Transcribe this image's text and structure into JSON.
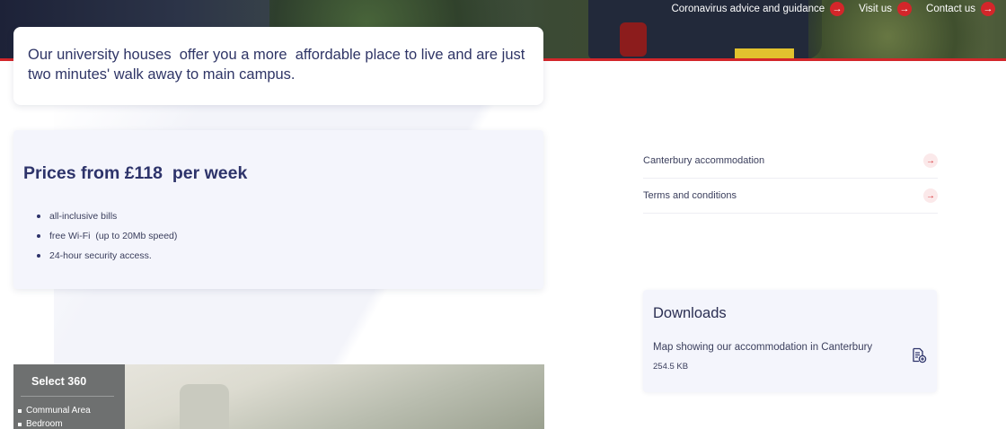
{
  "topnav": {
    "links": [
      {
        "label": "Coronavirus advice and guidance"
      },
      {
        "label": "Visit us"
      },
      {
        "label": "Contact us"
      }
    ]
  },
  "intro": {
    "text": "Our university houses  offer you a more  affordable place to live and are just two minutes' walk away to main campus."
  },
  "prices": {
    "heading": "Prices from £118  per week",
    "items": [
      "all-inclusive bills",
      "free Wi-Fi  (up to 20Mb speed)",
      "24-hour security access."
    ]
  },
  "viewer": {
    "title": "Select 360",
    "items": [
      "Communal Area",
      "Bedroom"
    ]
  },
  "sidebar": {
    "links": [
      {
        "label": "Canterbury accommodation"
      },
      {
        "label": "Terms and conditions"
      }
    ]
  },
  "downloads": {
    "title": "Downloads",
    "file": {
      "name": "Map showing our accommodation in Canterbury",
      "size": "254.5 KB",
      "icon": "document-download-icon"
    }
  },
  "colors": {
    "accent": "#d3262a",
    "heading": "#2d336a",
    "card_bg": "#f4f5fc"
  }
}
